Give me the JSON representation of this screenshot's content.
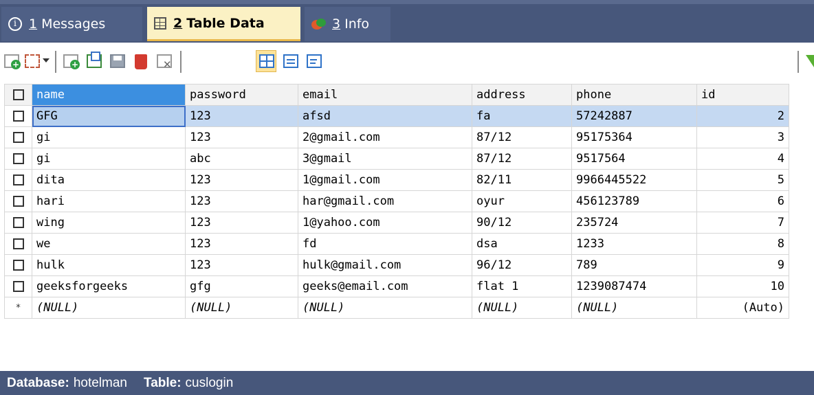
{
  "tabs": [
    {
      "num": "1",
      "label": "Messages",
      "icon": "info-icon"
    },
    {
      "num": "2",
      "label": "Table Data",
      "icon": "grid-icon"
    },
    {
      "num": "3",
      "label": "Info",
      "icon": "pie-chart-icon"
    }
  ],
  "colors": {
    "tab_bar": "#47577b",
    "active_tab": "#fbf1c4",
    "header_selected": "#3c8fe0",
    "row_selected": "#c5d9f2"
  },
  "toolbar_icons": [
    "add-row-icon",
    "dropdown-grid-icon",
    "insert-row-icon",
    "copy-row-icon",
    "save-icon",
    "delete-icon",
    "cancel-icon",
    "grid-view-icon",
    "form-view-icon",
    "text-view-icon",
    "filter-icon"
  ],
  "table": {
    "columns": [
      "name",
      "password",
      "email",
      "address",
      "phone",
      "id"
    ],
    "rows": [
      [
        "GFG",
        "123",
        "afsd",
        "fa",
        "57242887",
        "2"
      ],
      [
        "gi",
        "123",
        "2@gmail.com",
        "87/12",
        "95175364",
        "3"
      ],
      [
        "gi",
        "abc",
        "3@gmail",
        "87/12",
        "9517564",
        "4"
      ],
      [
        "dita",
        "123",
        "1@gmail.com",
        "82/11",
        "9966445522",
        "5"
      ],
      [
        "hari",
        "123",
        "har@gmail.com",
        "oyur",
        "456123789",
        "6"
      ],
      [
        "wing",
        "123",
        "1@yahoo.com",
        "90/12",
        "235724",
        "7"
      ],
      [
        "we",
        "123",
        "fd",
        "dsa",
        "1233",
        "8"
      ],
      [
        "hulk",
        "123",
        "hulk@gmail.com",
        "96/12",
        "789",
        "9"
      ],
      [
        "geeksforgeeks",
        "gfg",
        "geeks@email.com",
        "flat 1",
        "1239087474",
        "10"
      ]
    ],
    "new_row": {
      "marker": "*",
      "values": [
        "(NULL)",
        "(NULL)",
        "(NULL)",
        "(NULL)",
        "(NULL)",
        "(Auto)"
      ]
    }
  },
  "status": {
    "db_label": "Database:",
    "db_value": "hotelman",
    "table_label": "Table:",
    "table_value": "cuslogin"
  }
}
